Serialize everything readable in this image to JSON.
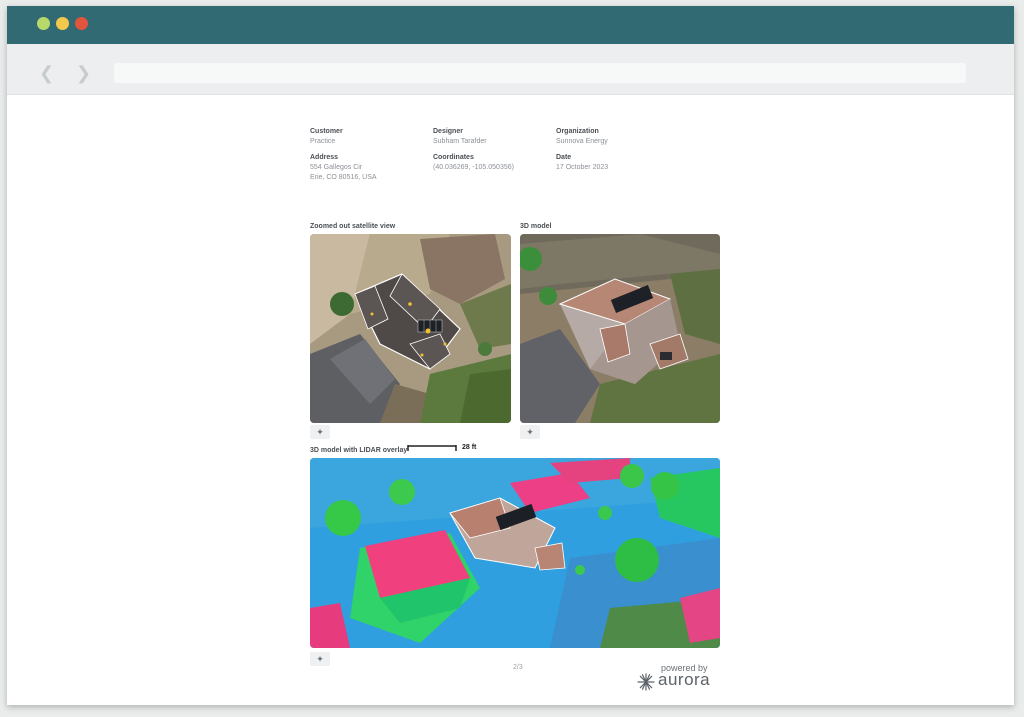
{
  "browser": {
    "traffic_lights": [
      "#b7d86a",
      "#f2c94c",
      "#e0553b"
    ],
    "titlebar_color": "#326a73"
  },
  "report": {
    "customer_label": "Customer",
    "customer_value": "Practice",
    "designer_label": "Designer",
    "designer_value": "Subham Tarafder",
    "organization_label": "Organization",
    "organization_value": "Sunnova Energy",
    "address_label": "Address",
    "address_line1": "554 Gallegos Cir",
    "address_line2": "Erie, CO 80516, USA",
    "coordinates_label": "Coordinates",
    "coordinates_value": "(40.036269, -105.050356)",
    "date_label": "Date",
    "date_value": "17 October 2023"
  },
  "views": {
    "satellite_title": "Zoomed out satellite view",
    "model_title": "3D model",
    "lidar_title": "3D model with LIDAR overlay",
    "scale_label": "28 ft",
    "center_icon": "crosshair-icon"
  },
  "footer": {
    "page": "2/3",
    "powered_by": "powered by",
    "brand": "aurora"
  }
}
